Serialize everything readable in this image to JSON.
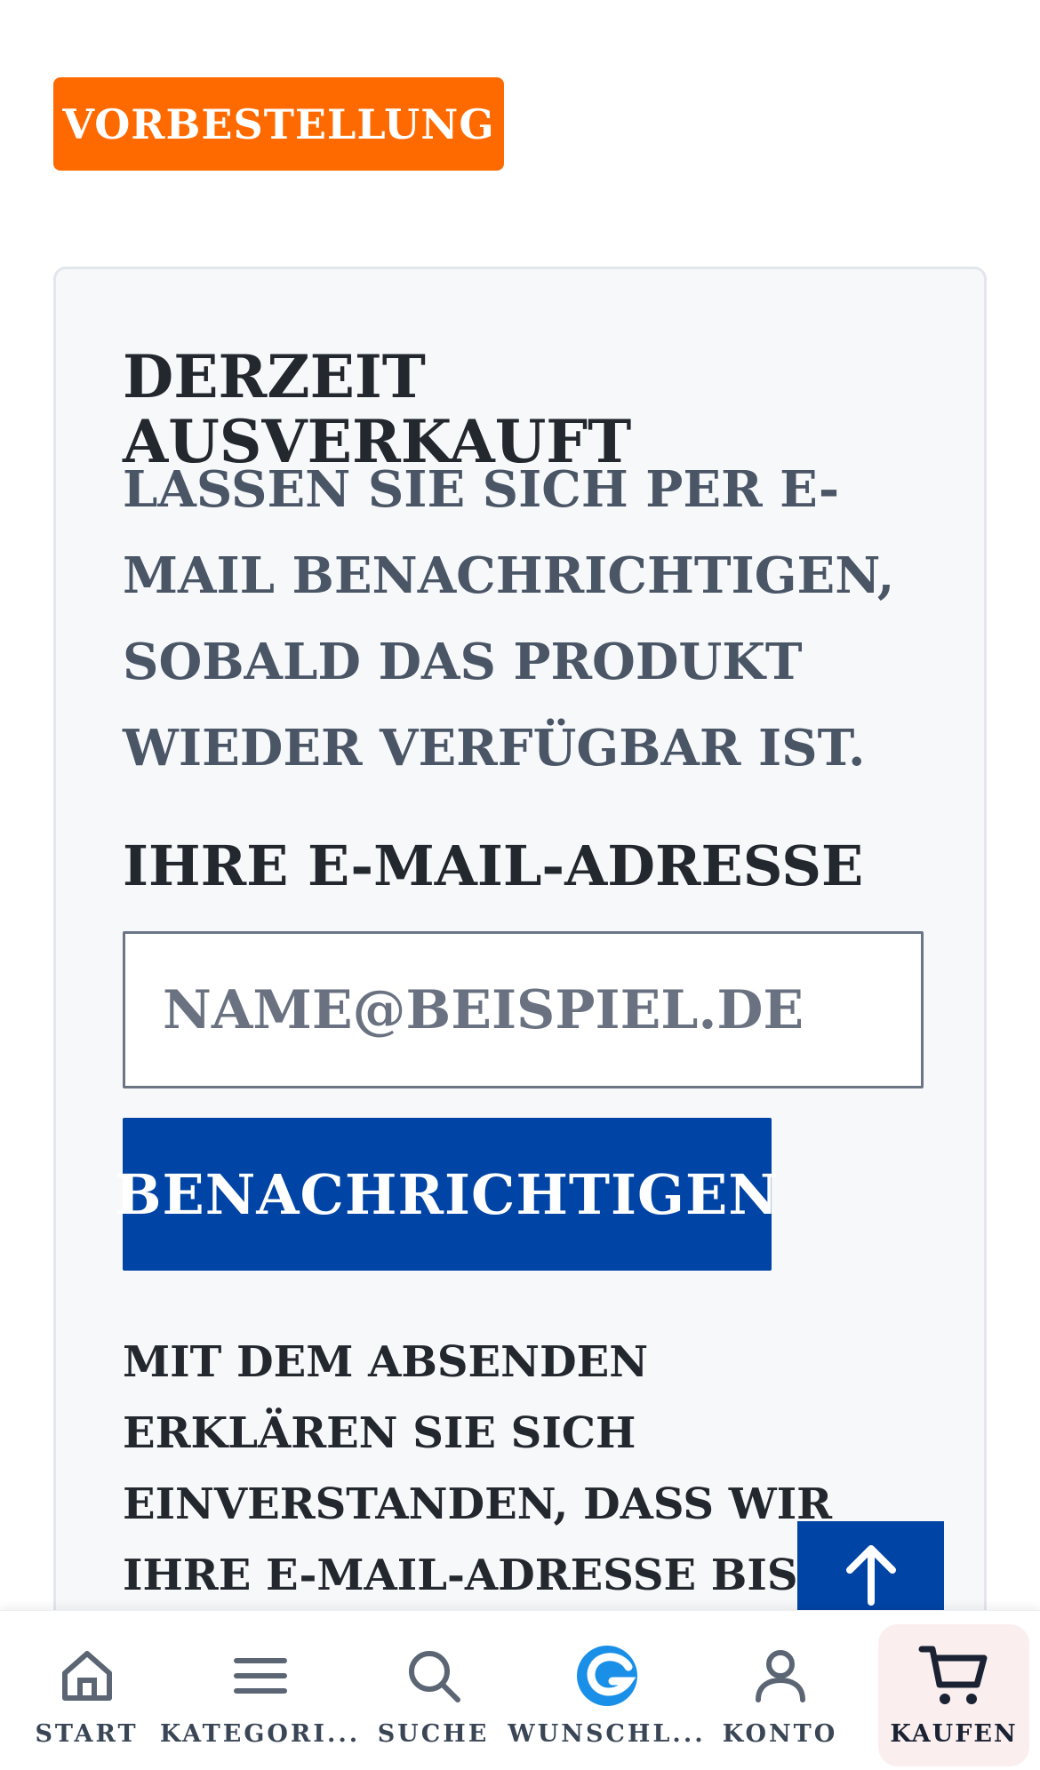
{
  "badge": {
    "label": "VORBESTELLUNG"
  },
  "restock": {
    "title": "DERZEIT AUSVERKAUFT",
    "description": "LASSEN SIE SICH PER E-MAIL BENACHRICHTIGEN, SOBALD DAS PRODUKT WIEDER VERFÜGBAR IST.",
    "email_label": "IHRE E-MAIL-ADRESSE",
    "email_value": "",
    "email_placeholder": "NAME@BEISPIEL.DE",
    "submit_label": "BENACHRICHTIGEN",
    "consent_text": "MIT DEM ABSENDEN ERKLÄREN SIE SICH EINVERSTANDEN, DASS WIR IHRE E-MAIL-ADRESSE BIS ZUR BENACHRICHTIGUNG ODER"
  },
  "colors": {
    "accent_orange": "#ff6a00",
    "primary_blue": "#0044a5",
    "wishlist_icon": "#1a8fe8"
  },
  "bottom_nav": {
    "items": [
      {
        "label": "START",
        "icon": "home-icon"
      },
      {
        "label": "KATEGORI...",
        "icon": "menu-icon"
      },
      {
        "label": "SUCHE",
        "icon": "search-icon"
      },
      {
        "label": "WUNSCHL...",
        "icon": "wishlist-icon"
      },
      {
        "label": "KONTO",
        "icon": "user-icon"
      },
      {
        "label": "KAUFEN",
        "icon": "cart-icon"
      }
    ]
  }
}
